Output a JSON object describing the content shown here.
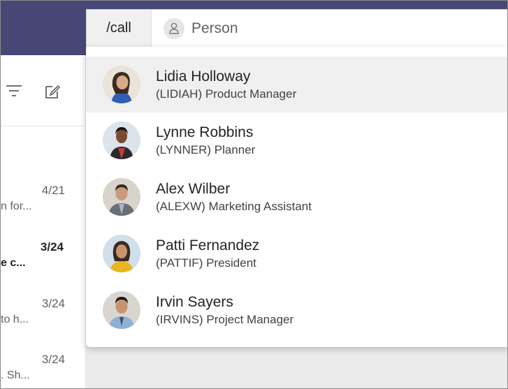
{
  "search": {
    "command": "/call",
    "placeholder": "Person"
  },
  "chat_list": [
    {
      "date": "4/21",
      "preview": "n for...",
      "unread": false
    },
    {
      "date": "3/24",
      "preview": "e c...",
      "unread": true
    },
    {
      "date": "3/24",
      "preview": "to h...",
      "unread": false
    },
    {
      "date": "3/24",
      "preview": ". Sh...",
      "unread": false
    }
  ],
  "suggestions": [
    {
      "name": "Lidia Holloway",
      "detail": "(LIDIAH) Product Manager",
      "active": true
    },
    {
      "name": "Lynne Robbins",
      "detail": "(LYNNER) Planner",
      "active": false
    },
    {
      "name": "Alex Wilber",
      "detail": "(ALEXW) Marketing Assistant",
      "active": false
    },
    {
      "name": "Patti Fernandez",
      "detail": "(PATTIF) President",
      "active": false
    },
    {
      "name": "Irvin Sayers",
      "detail": "(IRVINS) Project Manager",
      "active": false
    }
  ],
  "colors": {
    "topbar": "#464775",
    "active_row": "#f0f0f0",
    "background": "#ebebeb"
  }
}
